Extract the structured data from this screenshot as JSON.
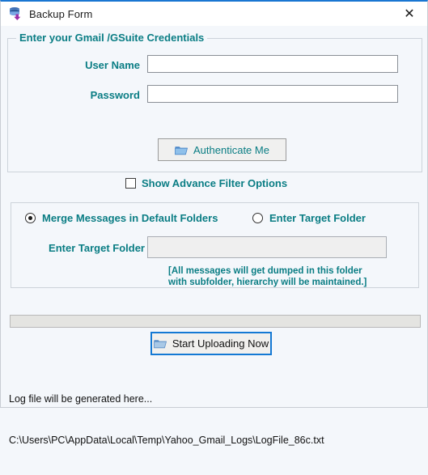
{
  "window": {
    "title": "Backup Form",
    "icon": "database-stack-icon",
    "close_label": "✕",
    "accent_color": "#1976d2",
    "background_color": "#f4f7fb",
    "label_color": "#0a7d84"
  },
  "credentials": {
    "legend": "Enter your Gmail /GSuite Credentials",
    "username": {
      "label": "User Name",
      "value": "",
      "placeholder": ""
    },
    "password": {
      "label": "Password",
      "value": "",
      "placeholder": ""
    },
    "authenticate_button": {
      "label": "Authenticate Me",
      "icon": "folder-icon"
    }
  },
  "advance_filter": {
    "label": "Show Advance Filter Options",
    "checked": false
  },
  "target": {
    "radio_merge": {
      "label": "Merge Messages in Default Folders",
      "selected": true
    },
    "radio_target": {
      "label": "Enter Target Folder",
      "selected": false
    },
    "target_field": {
      "label": "Enter Target Folder",
      "value": "",
      "placeholder": "",
      "disabled": true
    },
    "hint_line1": "[All messages will get dumped in this folder",
    "hint_line2": "with subfolder, hierarchy will be maintained.]"
  },
  "progress": {
    "value": 0,
    "max": 100
  },
  "upload_button": {
    "label": "Start Uploading Now",
    "icon": "folder-icon",
    "focused": true
  },
  "log": {
    "line1": "Log file will be generated here...",
    "line2": "C:\\Users\\PC\\AppData\\Local\\Temp\\Yahoo_Gmail_Logs\\LogFile_86c.txt"
  }
}
